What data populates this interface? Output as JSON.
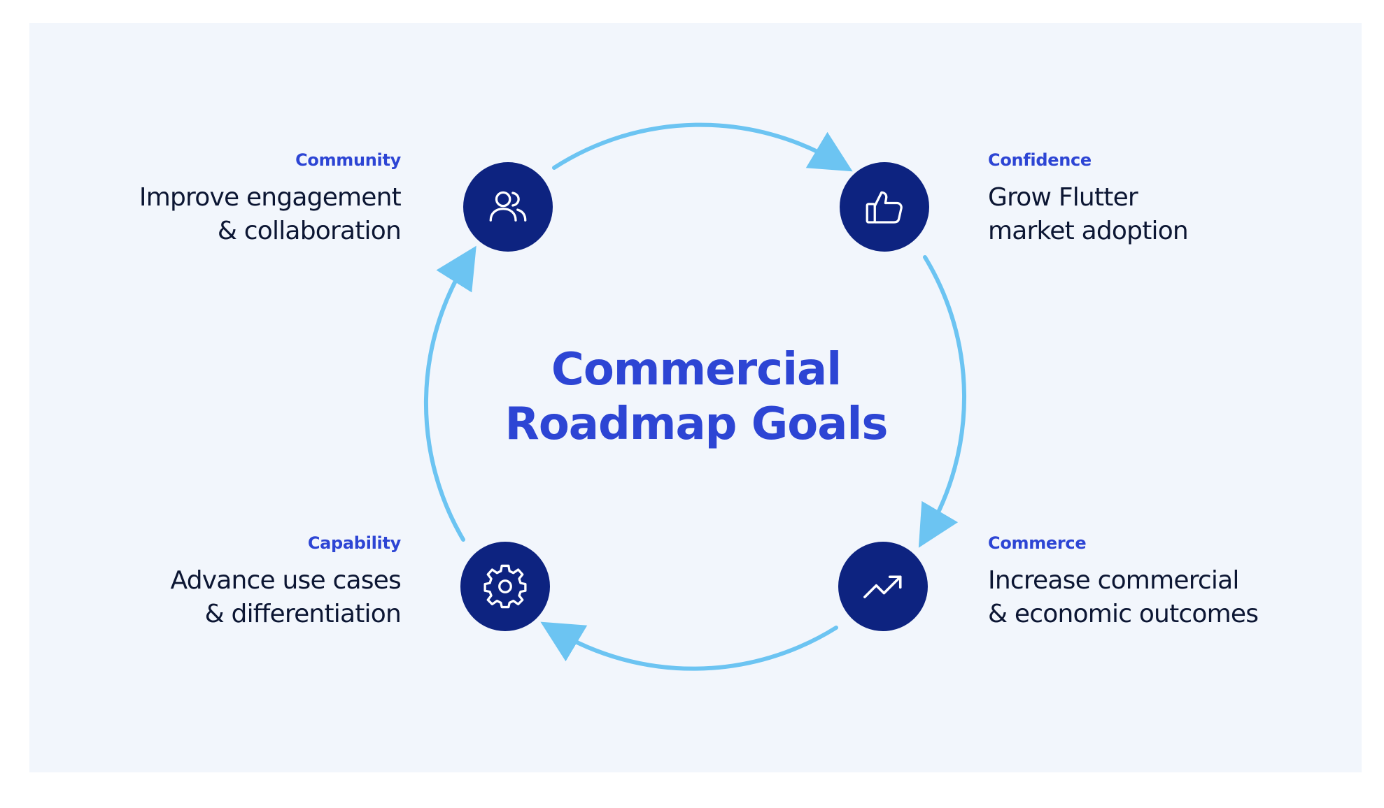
{
  "title": {
    "line1": "Commercial",
    "line2": "Roadmap Goals"
  },
  "goals": [
    {
      "category": "Community",
      "line1": "Improve engagement",
      "line2": "& collaboration",
      "icon": "users-icon"
    },
    {
      "category": "Confidence",
      "line1": "Grow Flutter",
      "line2": "market adoption",
      "icon": "thumbs-up-icon"
    },
    {
      "category": "Commerce",
      "line1": "Increase commercial",
      "line2": "& economic outcomes",
      "icon": "trending-up-icon"
    },
    {
      "category": "Capability",
      "line1": "Advance use cases",
      "line2": "& differentiation",
      "icon": "gear-icon"
    }
  ],
  "colors": {
    "background": "#f2f6fc",
    "node_fill": "#0d2380",
    "accent": "#2d45d4",
    "arrow": "#6cc4f2",
    "text": "#0c1633"
  }
}
